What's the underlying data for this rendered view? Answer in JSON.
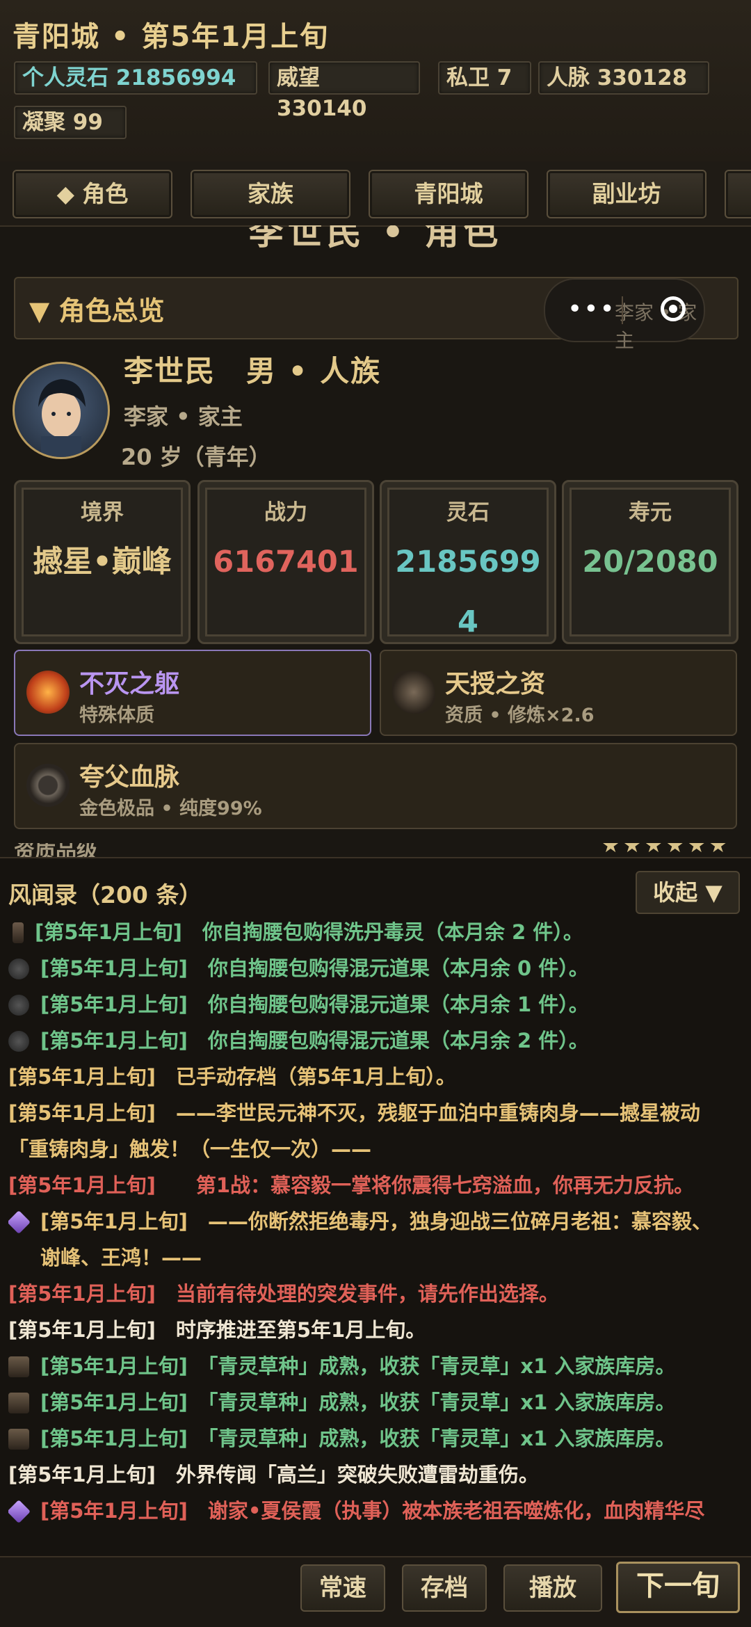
{
  "header": {
    "title": "青阳城 • 第5年1月上旬",
    "stats": [
      {
        "label": "个人灵石 21856994",
        "highlight": true
      },
      {
        "label": "威望 330140"
      },
      {
        "label": "私卫 7"
      },
      {
        "label": "人脉 330128"
      },
      {
        "label": "凝聚 99"
      }
    ]
  },
  "tabs": [
    {
      "label": "◆ 角色",
      "active": true
    },
    {
      "label": "家族"
    },
    {
      "label": "青阳城"
    },
    {
      "label": "副业坊"
    }
  ],
  "page_heading": "李世民 • 角色",
  "overview": {
    "section_label": "▼ 角色总览",
    "capsule_menu": "•••",
    "capsule_behind_text": "李家 • 家主"
  },
  "profile": {
    "name_line": "李世民　男 • 人族",
    "family_line": "李家 • 家主",
    "age_line": "20 岁（青年）"
  },
  "cards": [
    {
      "label": "境界",
      "value": "撼星•巅峰",
      "color": "#e3c98a"
    },
    {
      "label": "战力",
      "value": "6167401",
      "color": "#e0645d"
    },
    {
      "label": "灵石",
      "value": "21856994",
      "color": "#69c6c2"
    },
    {
      "label": "寿元",
      "value": "20/2080",
      "color": "#78c290"
    }
  ],
  "traits": [
    {
      "name": "不灭之躯",
      "sub": "特殊体质",
      "color": "#b995f0"
    },
    {
      "name": "天授之资",
      "sub": "资质 • 修炼×2.6",
      "color": "#e6c98b"
    },
    {
      "name": "夸父血脉",
      "sub": "金色极品 • 纯度99%",
      "color": "#e6c98b"
    }
  ],
  "partial_row": {
    "label": "资质品级",
    "stars": "★★★★★★"
  },
  "log": {
    "title": "风闻录（200 条）",
    "collapse_label": "收起 ▼",
    "entries": [
      {
        "text": "[第5年1月上旬]　你自掏腰包购得洗丹毒灵（本月余 2 件）。",
        "color": "green",
        "icon": "potion"
      },
      {
        "text": "[第5年1月上旬]　你自掏腰包购得混元道果（本月余 0 件）。",
        "color": "green",
        "icon": "fruit"
      },
      {
        "text": "[第5年1月上旬]　你自掏腰包购得混元道果（本月余 1 件）。",
        "color": "green",
        "icon": "fruit"
      },
      {
        "text": "[第5年1月上旬]　你自掏腰包购得混元道果（本月余 2 件）。",
        "color": "green",
        "icon": "fruit"
      },
      {
        "text": "[第5年1月上旬]　已手动存档（第5年1月上旬）。",
        "color": "gold"
      },
      {
        "text": "[第5年1月上旬]　——李世民元神不灭，残躯于血泊中重铸肉身——撼星被动",
        "color": "gold"
      },
      {
        "text": "「重铸肉身」触发！（一生仅一次）——",
        "color": "gold"
      },
      {
        "text": "[第5年1月上旬]　　第1战：慕容毅一掌将你震得七窍溢血，你再无力反抗。",
        "color": "red"
      },
      {
        "text": "[第5年1月上旬]　——你断然拒绝毒丹，独身迎战三位碎月老祖：慕容毅、",
        "color": "gold",
        "icon": "crystal"
      },
      {
        "text": "谢峰、王鸿！——",
        "color": "gold",
        "indent": true
      },
      {
        "text": "[第5年1月上旬]　当前有待处理的突发事件，请先作出选择。",
        "color": "red"
      },
      {
        "text": "[第5年1月上旬]　时序推进至第5年1月上旬。",
        "color": "white"
      },
      {
        "text": "[第5年1月上旬]　「青灵草种」成熟，收获「青灵草」x1 入家族库房。",
        "color": "green",
        "icon": "chest"
      },
      {
        "text": "[第5年1月上旬]　「青灵草种」成熟，收获「青灵草」x1 入家族库房。",
        "color": "green",
        "icon": "chest"
      },
      {
        "text": "[第5年1月上旬]　「青灵草种」成熟，收获「青灵草」x1 入家族库房。",
        "color": "green",
        "icon": "chest"
      },
      {
        "text": "[第5年1月上旬]　外界传闻「高兰」突破失败遭雷劫重伤。",
        "color": "white"
      },
      {
        "text": "[第5年1月上旬]　谢家•夏侯霞（执事）被本族老祖吞噬炼化，血肉精华尽",
        "color": "red",
        "icon": "crystal"
      }
    ]
  },
  "bottom": {
    "speed_label": "常速",
    "save_label": "存档",
    "play_label": "播放",
    "next_label": "下一旬"
  }
}
